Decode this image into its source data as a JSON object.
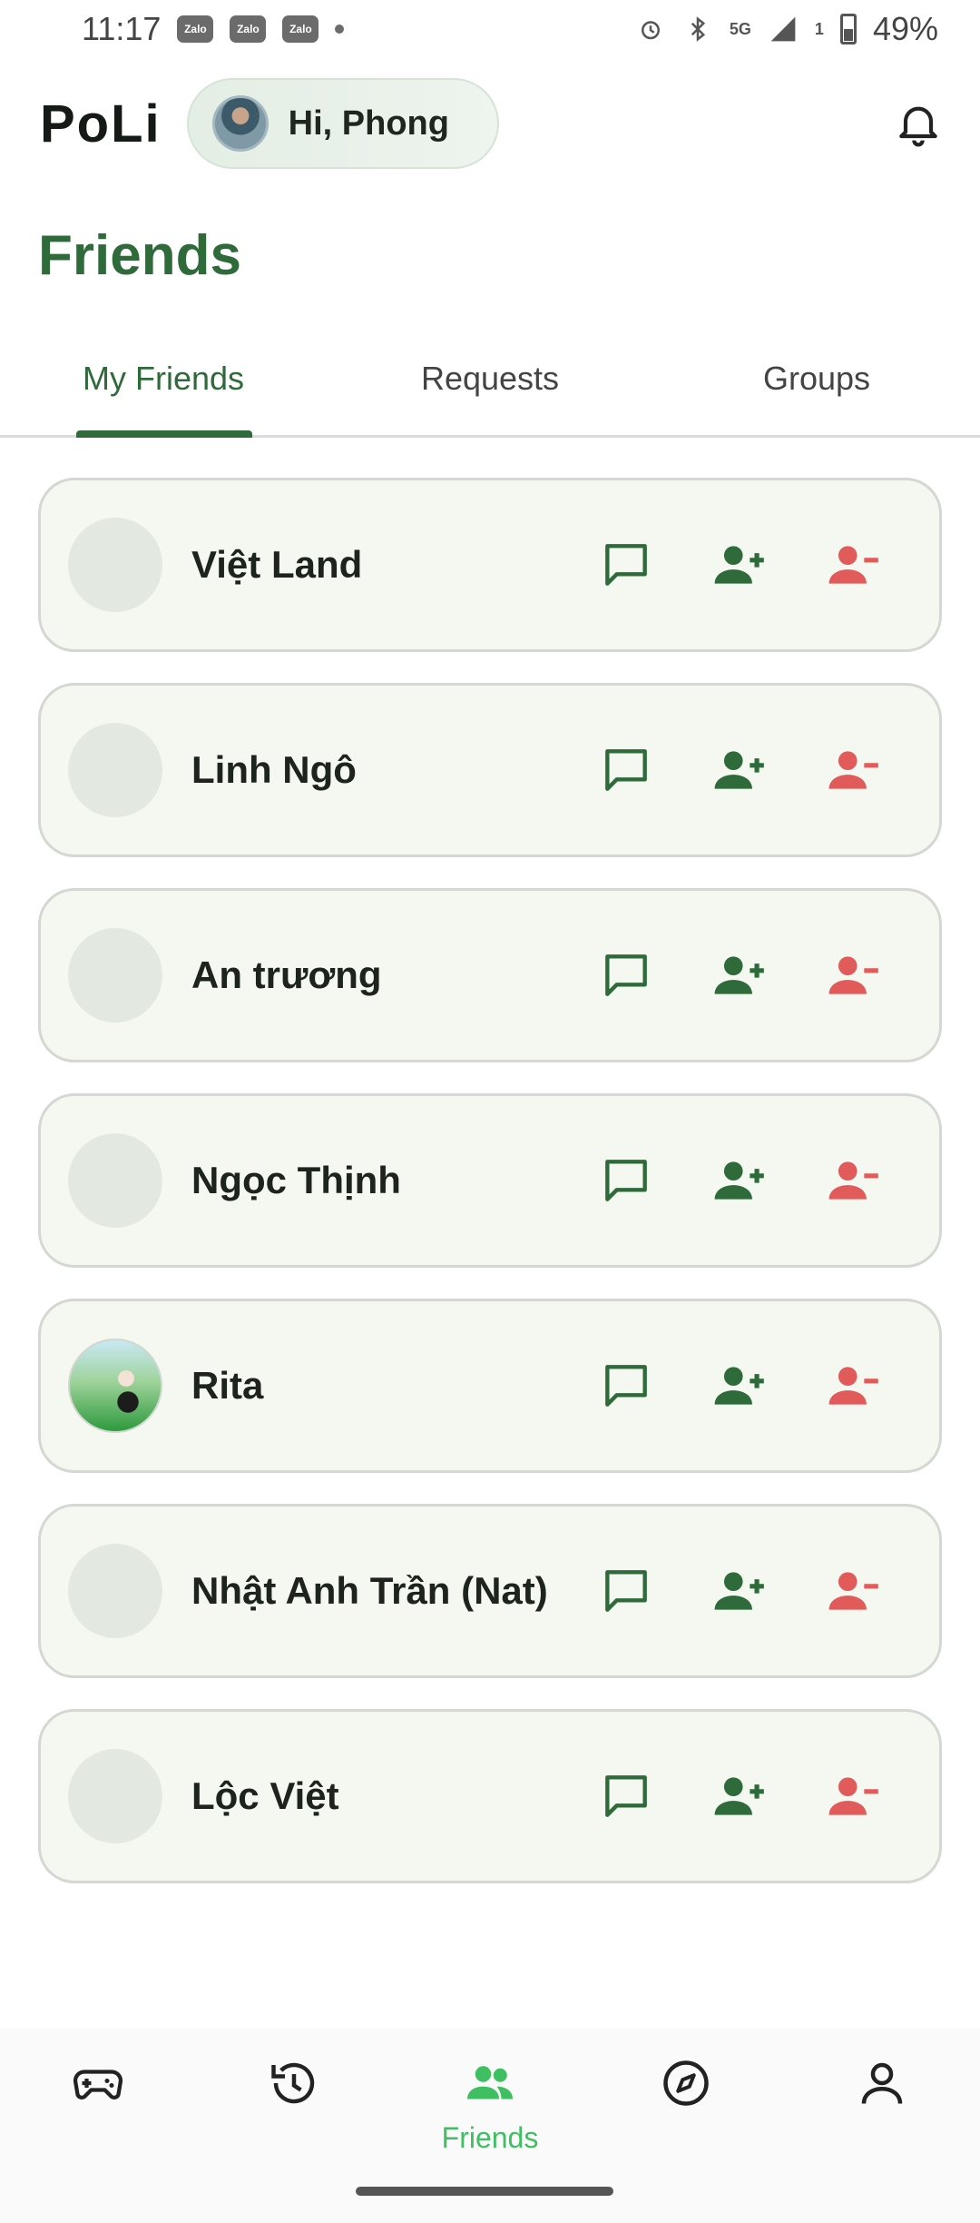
{
  "status_bar": {
    "time": "11:17",
    "notification_badges": [
      "Zalo",
      "Zalo",
      "Zalo"
    ],
    "network": "5G",
    "sim_badge": "1",
    "battery": "49%"
  },
  "header": {
    "logo": "PoLi",
    "greeting": "Hi, Phong"
  },
  "page": {
    "title": "Friends"
  },
  "tabs": [
    {
      "label": "My Friends",
      "active": true
    },
    {
      "label": "Requests",
      "active": false
    },
    {
      "label": "Groups",
      "active": false
    }
  ],
  "friends": [
    {
      "name": "Việt Land",
      "avatar": "placeholder"
    },
    {
      "name": "Linh Ngô",
      "avatar": "placeholder"
    },
    {
      "name": "An trương",
      "avatar": "placeholder"
    },
    {
      "name": "Ngọc Thịnh",
      "avatar": "placeholder"
    },
    {
      "name": "Rita",
      "avatar": "photo"
    },
    {
      "name": "Nhật Anh Trần (Nat)",
      "avatar": "placeholder"
    },
    {
      "name": "Lộc Việt",
      "avatar": "placeholder"
    }
  ],
  "bottom_nav": [
    {
      "icon": "gamepad-icon",
      "label": "",
      "active": false
    },
    {
      "icon": "history-icon",
      "label": "",
      "active": false
    },
    {
      "icon": "friends-icon",
      "label": "Friends",
      "active": true
    },
    {
      "icon": "compass-icon",
      "label": "",
      "active": false
    },
    {
      "icon": "profile-icon",
      "label": "",
      "active": false
    }
  ],
  "colors": {
    "brand_green": "#2f6a3a",
    "active_nav": "#3fbf62",
    "danger": "#e25b5b",
    "card_bg": "#f4f8f0"
  }
}
